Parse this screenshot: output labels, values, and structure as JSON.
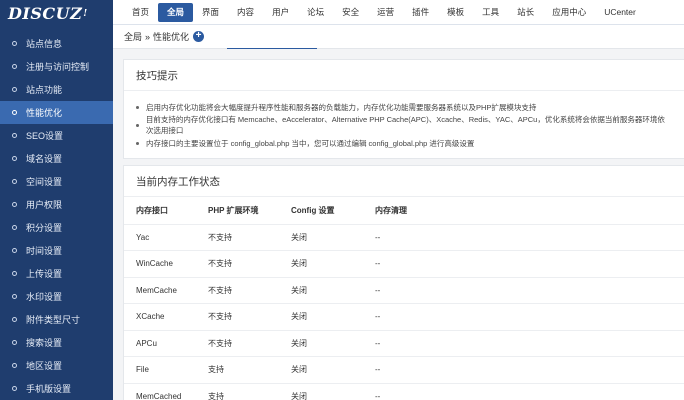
{
  "logo": {
    "text": "DISCUZ",
    "mark": "!"
  },
  "sidebar": {
    "items": [
      {
        "label": "站点信息"
      },
      {
        "label": "注册与访问控制"
      },
      {
        "label": "站点功能"
      },
      {
        "label": "性能优化",
        "active": true
      },
      {
        "label": "SEO设置"
      },
      {
        "label": "域名设置"
      },
      {
        "label": "空间设置"
      },
      {
        "label": "用户权限"
      },
      {
        "label": "积分设置"
      },
      {
        "label": "时间设置"
      },
      {
        "label": "上传设置"
      },
      {
        "label": "水印设置"
      },
      {
        "label": "附件类型尺寸"
      },
      {
        "label": "搜索设置"
      },
      {
        "label": "地区设置"
      },
      {
        "label": "手机版设置"
      }
    ]
  },
  "topnav": {
    "items": [
      {
        "label": "首页"
      },
      {
        "label": "全局",
        "active": true
      },
      {
        "label": "界面"
      },
      {
        "label": "内容"
      },
      {
        "label": "用户"
      },
      {
        "label": "论坛"
      },
      {
        "label": "安全"
      },
      {
        "label": "运营"
      },
      {
        "label": "插件"
      },
      {
        "label": "模板"
      },
      {
        "label": "工具"
      },
      {
        "label": "站长"
      },
      {
        "label": "应用中心"
      },
      {
        "label": "UCenter"
      }
    ]
  },
  "breadcrumb": {
    "root": "全局",
    "sep": "»",
    "current": "性能优化",
    "add": "+"
  },
  "tips": {
    "title": "技巧提示",
    "items": [
      "启用内存优化功能将会大幅度提升程序性能和服务器的负载能力，内存优化功能需要服务器系统以及PHP扩展模块支持",
      "目前支持的内存优化接口有 Memcache、eAccelerator、Alternative PHP Cache(APC)、Xcache、Redis、YAC、APCu，优化系统将会依据当前服务器环境依次选用接口",
      "内存接口的主要设置位于 config_global.php 当中，您可以通过编辑 config_global.php 进行高级设置"
    ]
  },
  "status": {
    "title": "当前内存工作状态",
    "columns": [
      "内存接口",
      "PHP 扩展环境",
      "Config 设置",
      "内存清理"
    ],
    "rows": [
      [
        "Yac",
        "不支持",
        "关闭",
        "--"
      ],
      [
        "WinCache",
        "不支持",
        "关闭",
        "--"
      ],
      [
        "MemCache",
        "不支持",
        "关闭",
        "--"
      ],
      [
        "XCache",
        "不支持",
        "关闭",
        "--"
      ],
      [
        "APCu",
        "不支持",
        "关闭",
        "--"
      ],
      [
        "File",
        "支持",
        "关闭",
        "--"
      ],
      [
        "MemCached",
        "支持",
        "关闭",
        "--"
      ]
    ]
  },
  "colors": {
    "sidebar_bg": "#1f3d6e",
    "accent": "#2b5aa0",
    "active_side": "#3a6ab0"
  }
}
